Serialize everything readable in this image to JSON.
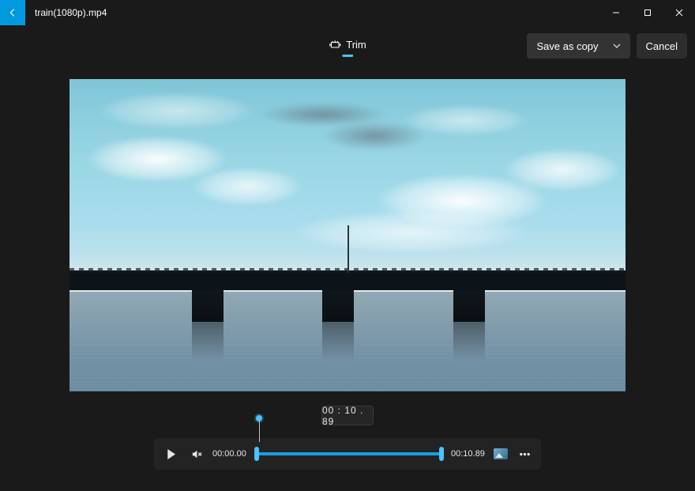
{
  "titlebar": {
    "filename": "train(1080p).mp4"
  },
  "toolbar": {
    "trim_label": "Trim",
    "save_as_copy_label": "Save as copy",
    "cancel_label": "Cancel"
  },
  "selection": {
    "duration_display": "00 : 10 . 89"
  },
  "playback": {
    "start_time": "00:00.00",
    "end_time": "00:10.89",
    "trim_start_pct": 0,
    "trim_end_pct": 100,
    "playhead_pct": 2
  }
}
